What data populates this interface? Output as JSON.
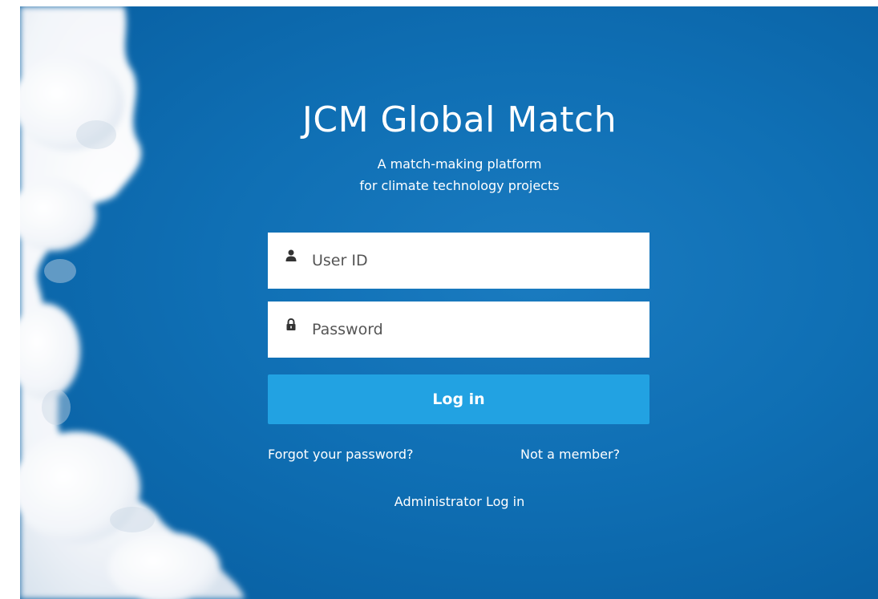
{
  "brand": {
    "title": "JCM Global Match",
    "subtitle_line1": "A match-making platform",
    "subtitle_line2": "for climate technology projects"
  },
  "form": {
    "user_id": {
      "placeholder": "User ID",
      "value": "",
      "icon": "user-icon"
    },
    "password": {
      "placeholder": "Password",
      "value": "",
      "icon": "lock-icon"
    },
    "login_label": "Log in"
  },
  "links": {
    "forgot_password": "Forgot your password?",
    "not_member": "Not a member?",
    "admin_login": "Administrator Log in"
  },
  "colors": {
    "sky_blue": "#0f6fb4",
    "button_blue": "#22a2e2",
    "text": "#ffffff"
  }
}
